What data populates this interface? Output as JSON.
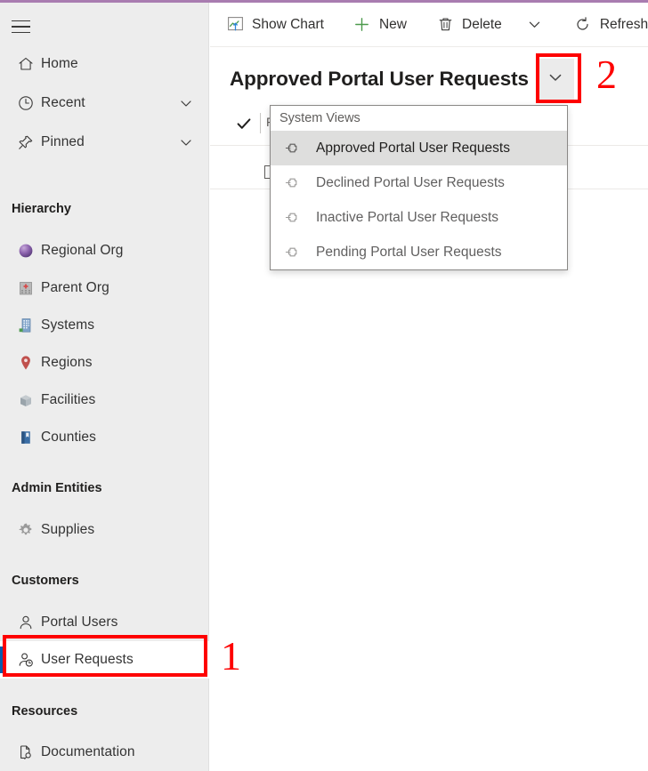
{
  "theme": {
    "accent_top_line": "#a97cb0",
    "sidebar_bg": "#ededed",
    "selected_row_bg": "#ffffff",
    "selected_indicator": "#0b5cab",
    "annotation_red": "#fe0000",
    "dropdown_active_bg": "#dededd"
  },
  "sidebar": {
    "hamburger_label": "site-map-toggle",
    "nav": [
      {
        "label": "Home",
        "icon": "home-icon",
        "has_chevron": false
      },
      {
        "label": "Recent",
        "icon": "clock-icon",
        "has_chevron": true
      },
      {
        "label": "Pinned",
        "icon": "pin-icon",
        "has_chevron": true
      }
    ],
    "groups": [
      {
        "title": "Hierarchy",
        "items": [
          {
            "label": "Regional Org",
            "icon": "purple-sphere-icon"
          },
          {
            "label": "Parent Org",
            "icon": "hospital-icon"
          },
          {
            "label": "Systems",
            "icon": "office-building-icon"
          },
          {
            "label": "Regions",
            "icon": "map-pin-icon"
          },
          {
            "label": "Facilities",
            "icon": "facility-cube-icon"
          },
          {
            "label": "Counties",
            "icon": "blue-book-icon"
          }
        ]
      },
      {
        "title": "Admin Entities",
        "items": [
          {
            "label": "Supplies",
            "icon": "gear-icon"
          }
        ]
      },
      {
        "title": "Customers",
        "items": [
          {
            "label": "Portal Users",
            "icon": "person-icon"
          },
          {
            "label": "User Requests",
            "icon": "person-clock-icon",
            "selected": true
          }
        ]
      },
      {
        "title": "Resources",
        "items": [
          {
            "label": "Documentation",
            "icon": "document-search-icon"
          }
        ]
      }
    ]
  },
  "commandbar": {
    "buttons": [
      {
        "label": "Show Chart",
        "icon": "chart-icon"
      },
      {
        "label": "New",
        "icon": "plus-icon"
      },
      {
        "label": "Delete",
        "icon": "trash-icon"
      },
      {
        "label": "",
        "icon": "chevron-down-icon"
      },
      {
        "label": "Refresh",
        "icon": "refresh-icon"
      }
    ]
  },
  "view_selector": {
    "title": "Approved Portal User Requests",
    "chevron_icon": "chevron-down-icon"
  },
  "grid_behind": {
    "check_icon": "checkmark-icon",
    "filter_text": "F",
    "row_checkbox": "unchecked"
  },
  "dropdown": {
    "header": "System Views",
    "items": [
      {
        "label": "Approved Portal User Requests",
        "icon": "pin-icon",
        "active": true
      },
      {
        "label": "Declined Portal User Requests",
        "icon": "pin-icon",
        "active": false
      },
      {
        "label": "Inactive Portal User Requests",
        "icon": "pin-icon",
        "active": false
      },
      {
        "label": "Pending Portal User Requests",
        "icon": "pin-icon",
        "active": false
      }
    ]
  },
  "annotations": [
    {
      "number": "1",
      "target": "sidebar-item-user-requests"
    },
    {
      "number": "2",
      "target": "view-selector-chevron"
    }
  ]
}
